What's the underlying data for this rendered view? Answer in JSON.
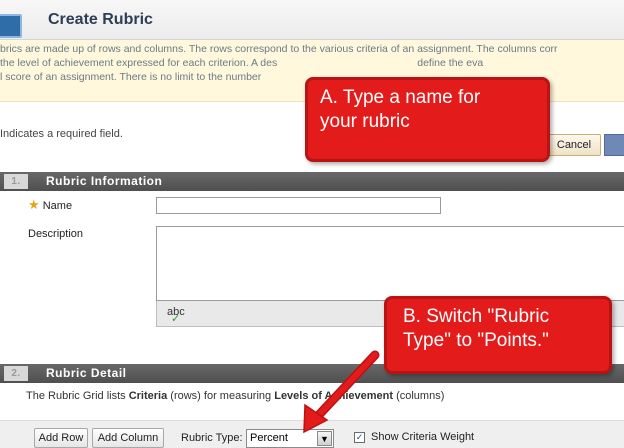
{
  "header": {
    "title": "Create Rubric",
    "icon": "rubric-icon"
  },
  "intro": {
    "line1": "brics are made up of rows and columns. The rows correspond to the various criteria of an assignment. The columns corr",
    "line2": "the level of achievement expressed for each criterion. A des",
    "line2b": "define the eva",
    "line3": "l score of an assignment. There is no limit to the number"
  },
  "required_note": "Indicates a required field.",
  "buttons": {
    "cancel": "Cancel"
  },
  "sections": {
    "info": {
      "num": "1.",
      "title": "Rubric Information"
    },
    "detail": {
      "num": "2.",
      "title": "Rubric Detail"
    }
  },
  "form": {
    "name_label": "Name",
    "name_value": "",
    "description_label": "Description",
    "spell_icon": "abc"
  },
  "grid": {
    "text_pre": "The Rubric Grid lists ",
    "criteria": "Criteria",
    "text_mid": " (rows) for measuring ",
    "levels": "Levels of Achievement",
    "text_post": " (columns)"
  },
  "toolbar": {
    "add_row": "Add Row",
    "add_column": "Add Column",
    "rubric_type_label": "Rubric Type:",
    "rubric_type_value": "Percent",
    "show_criteria_weight": "Show Criteria Weight",
    "show_criteria_weight_checked": true
  },
  "callouts": {
    "a_line1": "A. Type a name for",
    "a_line2": "your rubric",
    "b_line1": "B. Switch \"Rubric",
    "b_line2": "Type\" to \"Points.\""
  },
  "colors": {
    "callout": "#e31b1b",
    "section_bar": "#5a5a5a",
    "intro_bg": "#fff8dd"
  }
}
